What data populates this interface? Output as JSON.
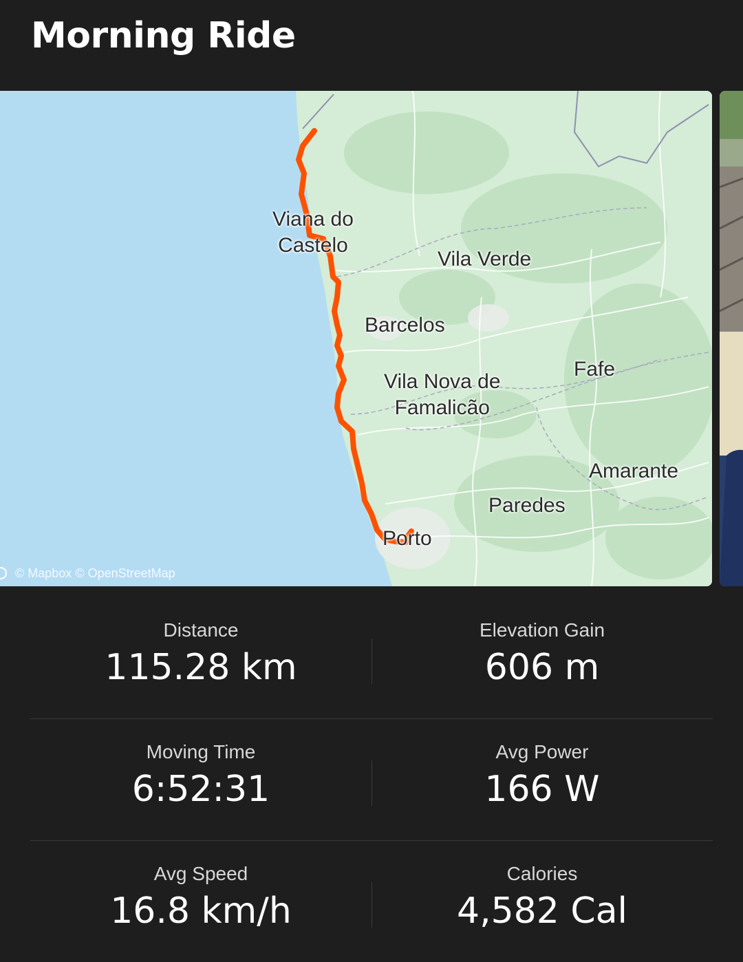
{
  "activity": {
    "title": "Morning Ride"
  },
  "map": {
    "attribution": "© Mapbox © OpenStreetMap",
    "route_color": "#fc5200",
    "water_color": "#b3dcf3",
    "land_color": "#d5ecd6",
    "labels": {
      "viana": "Viana do\nCastelo",
      "vila_verde": "Vila Verde",
      "barcelos": "Barcelos",
      "famalicao": "Vila Nova de\nFamalicão",
      "fafe": "Fafe",
      "amarante": "Amarante",
      "paredes": "Paredes",
      "porto": "Porto"
    }
  },
  "stats": {
    "distance": {
      "label": "Distance",
      "value": "115.28 km"
    },
    "elevation": {
      "label": "Elevation Gain",
      "value": "606 m"
    },
    "moving_time": {
      "label": "Moving Time",
      "value": "6:52:31"
    },
    "avg_power": {
      "label": "Avg Power",
      "value": "166 W"
    },
    "avg_speed": {
      "label": "Avg Speed",
      "value": "16.8 km/h"
    },
    "calories": {
      "label": "Calories",
      "value": "4,582 Cal"
    }
  }
}
